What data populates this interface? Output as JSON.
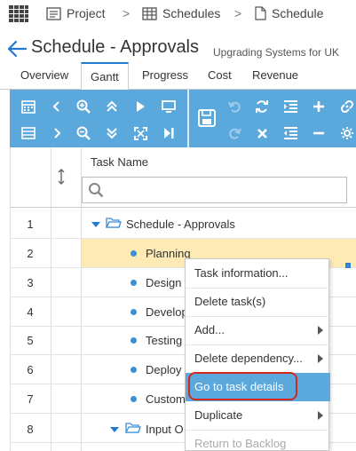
{
  "breadcrumb": {
    "items": [
      {
        "label": "Project",
        "icon": "project-icon"
      },
      {
        "label": "Schedules",
        "icon": "schedules-grid-icon"
      },
      {
        "label": "Schedule",
        "icon": "document-icon"
      }
    ],
    "separator": ">"
  },
  "header": {
    "title": "Schedule - Approvals",
    "subtitle": "Upgrading Systems for UK"
  },
  "tabs": [
    {
      "label": "Overview",
      "active": false
    },
    {
      "label": "Gantt",
      "active": true
    },
    {
      "label": "Progress",
      "active": false
    },
    {
      "label": "Cost",
      "active": false
    },
    {
      "label": "Revenue",
      "active": false
    }
  ],
  "toolbar": {
    "color": "#5ba8dd",
    "buttons": [
      "calendar-icon",
      "chevron-left-icon",
      "zoom-in-icon",
      "collapse-up-icon",
      "play-icon",
      "monitor-icon",
      "list-icon",
      "chevron-right-icon",
      "zoom-out-icon",
      "expand-down-icon",
      "fit-icon",
      "skip-end-icon",
      "save-icon",
      "undo-icon",
      "refresh-icon",
      "indent-icon",
      "add-icon",
      "redo-icon",
      "delete-icon",
      "outdent-icon",
      "remove-icon",
      "settings-icon"
    ]
  },
  "grid": {
    "columns": {
      "sort": "sort-icon",
      "task_name": "Task Name"
    },
    "filter_placeholder": "",
    "rows": [
      {
        "num": "1",
        "name": "Schedule - Approvals",
        "type": "folder",
        "expanded": true
      },
      {
        "num": "2",
        "name": "Planning",
        "type": "task",
        "selected": true
      },
      {
        "num": "3",
        "name": "Design",
        "type": "task"
      },
      {
        "num": "4",
        "name": "Develop",
        "type": "task"
      },
      {
        "num": "5",
        "name": "Testing",
        "type": "task"
      },
      {
        "num": "6",
        "name": "Deploy",
        "type": "task"
      },
      {
        "num": "7",
        "name": "Custom",
        "type": "task"
      },
      {
        "num": "8",
        "name": "Input O",
        "type": "folder",
        "expanded": true
      }
    ]
  },
  "context_menu": {
    "items": [
      {
        "label": "Task information...",
        "submenu": false
      },
      {
        "label": "Delete task(s)",
        "submenu": false
      },
      {
        "label": "Add...",
        "submenu": true
      },
      {
        "label": "Delete dependency...",
        "submenu": true
      },
      {
        "label": "Go to task details",
        "submenu": false,
        "highlighted": true
      },
      {
        "label": "Duplicate",
        "submenu": true
      },
      {
        "label": "Return to Backlog",
        "submenu": false,
        "disabled": true
      }
    ],
    "highlight_color": "#5ba8dd",
    "focus_ring_color": "#d0281f"
  }
}
